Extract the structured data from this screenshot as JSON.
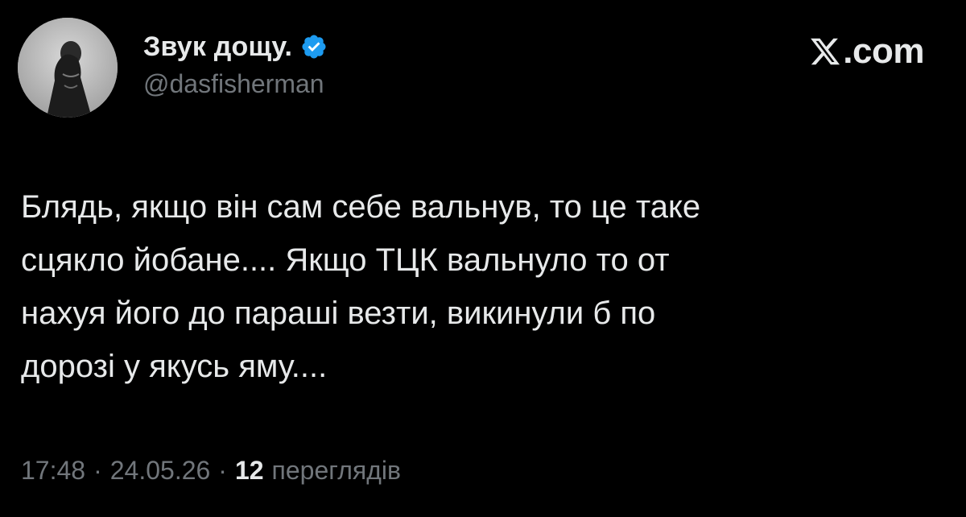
{
  "author": {
    "display_name": "Звук дощу.",
    "handle": "@dasfisherman",
    "verified": true,
    "avatar_icon": "profile-photo-avatar"
  },
  "brand": {
    "label": ".com",
    "icon": "x-logo-icon"
  },
  "tweet": {
    "text": "Блядь, якщо він сам себе вальнув, то це таке\nсцякло йобане.... Якщо ТЦК вальнуло то от\nнахуя його до параші везти, викинули б по\nдорозі у якусь яму...."
  },
  "meta": {
    "time": "17:48",
    "separator": "·",
    "date": "24.05.26",
    "views_count": "12",
    "views_label": "переглядів"
  },
  "colors": {
    "background": "#000000",
    "text_primary": "#e7e9ea",
    "text_secondary": "#71767b",
    "verified_badge": "#1d9bf0"
  }
}
